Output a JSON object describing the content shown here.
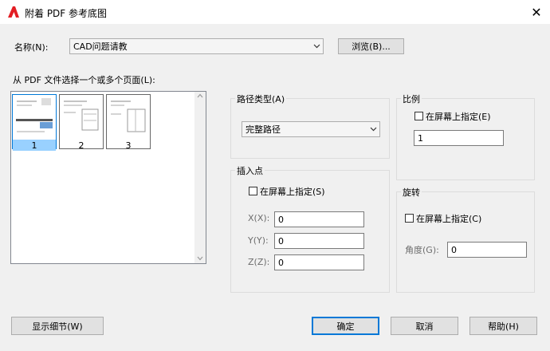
{
  "window": {
    "title": "附着 PDF 参考底图"
  },
  "name_row": {
    "label": "名称(N):",
    "value": "CAD问题请教",
    "browse_label": "浏览(B)..."
  },
  "pages": {
    "label": "从 PDF 文件选择一个或多个页面(L):",
    "items": [
      {
        "number": "1",
        "selected": true
      },
      {
        "number": "2",
        "selected": false
      },
      {
        "number": "3",
        "selected": false
      }
    ]
  },
  "path_type": {
    "title": "路径类型(A)",
    "value": "完整路径"
  },
  "insertion": {
    "title": "插入点",
    "on_screen": "在屏幕上指定(S)",
    "x_label": "X(X):",
    "x_value": "0",
    "y_label": "Y(Y):",
    "y_value": "0",
    "z_label": "Z(Z):",
    "z_value": "0"
  },
  "scale": {
    "title": "比例",
    "on_screen": "在屏幕上指定(E)",
    "value": "1"
  },
  "rotation": {
    "title": "旋转",
    "on_screen": "在屏幕上指定(C)",
    "angle_label": "角度(G):",
    "angle_value": "0"
  },
  "buttons": {
    "details": "显示细节(W)",
    "ok": "确定",
    "cancel": "取消",
    "help": "帮助(H)"
  },
  "colors": {
    "accent": "#0078d7",
    "selection": "#99d1ff",
    "app_icon": "#e31e24"
  }
}
